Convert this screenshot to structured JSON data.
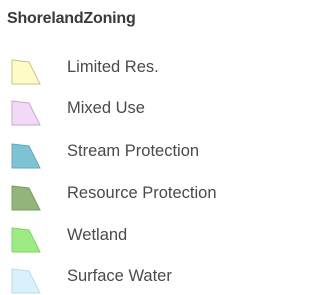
{
  "legend": {
    "title": "ShorelandZoning",
    "items": [
      {
        "label": "Limited Res.",
        "fill": "#FFFBC6",
        "stroke": "#C9C48C",
        "shape": "sheared-square"
      },
      {
        "label": "Mixed Use",
        "fill": "#F1D9F7",
        "stroke": "#C9A9D2",
        "shape": "sheared-square"
      },
      {
        "label": "Stream Protection",
        "fill": "#7EC3D5",
        "stroke": "#5FA8BC",
        "shape": "sheared-square"
      },
      {
        "label": "Resource Protection",
        "fill": "#93B57B",
        "stroke": "#78A062",
        "shape": "sheared-square"
      },
      {
        "label": "Wetland",
        "fill": "#9EEA84",
        "stroke": "#7FD168",
        "shape": "sheared-square"
      },
      {
        "label": "Surface Water",
        "fill": "#D9F1FB",
        "stroke": "#B6DDEE",
        "shape": "sheared-square"
      }
    ]
  }
}
